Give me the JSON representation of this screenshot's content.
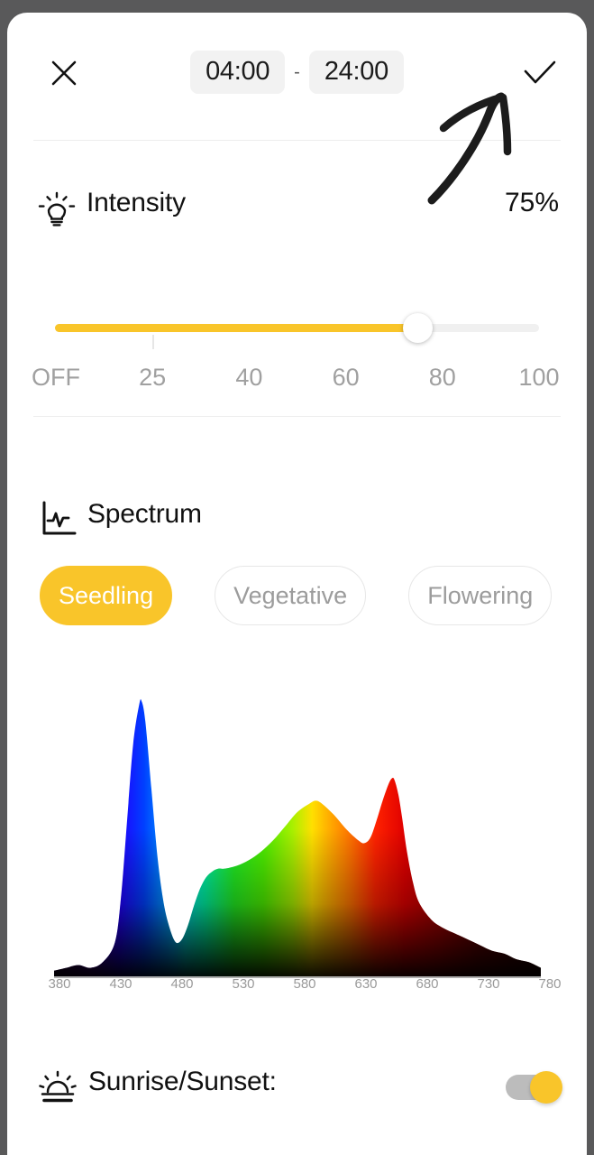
{
  "window": {
    "background_color": "#59595a",
    "card_color": "#ffffff"
  },
  "header": {
    "close_icon": "close-icon",
    "confirm_icon": "check-icon",
    "start_time": "04:00",
    "separator": "-",
    "end_time": "24:00"
  },
  "annotation": {
    "type": "hand-drawn-arrow",
    "points_to": "confirm-check-button",
    "color": "#1c1c1c"
  },
  "intensity": {
    "icon": "lightbulb-icon",
    "label": "Intensity",
    "value_text": "75%",
    "value": 75,
    "slider": {
      "min": 0,
      "max": 100,
      "current": 75,
      "fill_color": "#f9c52a",
      "track_color": "#f0f0f0",
      "thumb_color": "#ffffff",
      "tick_marks": [
        {
          "label": "OFF",
          "value": 0
        },
        {
          "label": "25",
          "value": 25
        },
        {
          "label": "40",
          "value": 40
        },
        {
          "label": "60",
          "value": 60
        },
        {
          "label": "80",
          "value": 80
        },
        {
          "label": "100",
          "value": 100
        }
      ]
    }
  },
  "spectrum": {
    "icon": "chart-line-icon",
    "label": "Spectrum",
    "modes": [
      {
        "label": "Seedling",
        "active": true
      },
      {
        "label": "Vegetative",
        "active": false
      },
      {
        "label": "Flowering",
        "active": false
      }
    ]
  },
  "chart_data": {
    "type": "area",
    "title": "",
    "xlabel": "",
    "ylabel": "",
    "xlim": [
      380,
      780
    ],
    "ylim": [
      0,
      100
    ],
    "grid": false,
    "legend": "none",
    "tick_labels": [
      "380",
      "430",
      "480",
      "530",
      "580",
      "630",
      "680",
      "730",
      "780"
    ],
    "x": [
      380,
      390,
      400,
      410,
      420,
      430,
      435,
      440,
      445,
      450,
      452,
      455,
      460,
      465,
      470,
      475,
      480,
      485,
      490,
      495,
      500,
      505,
      510,
      515,
      520,
      530,
      540,
      550,
      560,
      570,
      580,
      590,
      595,
      600,
      610,
      620,
      630,
      635,
      640,
      645,
      650,
      655,
      658,
      660,
      663,
      666,
      670,
      675,
      680,
      690,
      700,
      710,
      720,
      730,
      740,
      750,
      760,
      770,
      780
    ],
    "values": [
      2,
      3,
      4,
      3,
      5,
      12,
      28,
      55,
      82,
      96,
      97,
      90,
      66,
      42,
      26,
      17,
      12,
      13,
      18,
      25,
      31,
      35,
      37,
      38,
      38,
      39,
      41,
      44,
      48,
      53,
      58,
      61,
      62,
      61,
      57,
      52,
      48,
      47,
      49,
      55,
      62,
      68,
      70,
      69,
      64,
      56,
      44,
      33,
      26,
      20,
      17,
      15,
      13,
      11,
      9,
      8,
      6,
      5,
      3
    ],
    "fill": "wavelength-spectrum-gradient",
    "notes": "Blue peak ~450nm, trough ~480nm, broad green/amber hump peaking ~595nm, dip ~635nm, sharp deep-red peak ~660nm, long tail to 780nm"
  },
  "sunrise_sunset": {
    "icon": "sunrise-icon",
    "label": "Sunrise/Sunset:",
    "toggle_on": true,
    "toggle_knob_color": "#f9c52a",
    "toggle_track_color": "#bcbcbc"
  }
}
